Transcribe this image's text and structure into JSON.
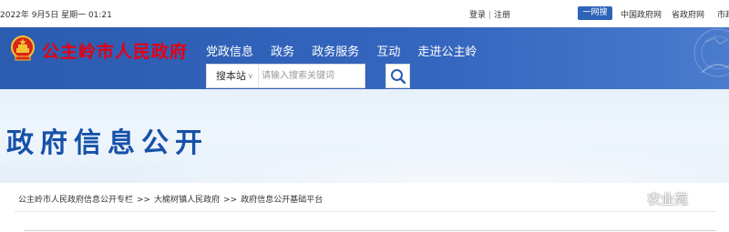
{
  "topbar": {
    "date": "2022年 9月5日 星期一 01:21",
    "login": "登录",
    "register": "注册",
    "quick_search": "一网搜",
    "links": [
      "中国政府网",
      "省政府网",
      "市政"
    ]
  },
  "header": {
    "site_name": "公主岭市人民政府",
    "nav": [
      "党政信息",
      "政务",
      "政务服务",
      "互动",
      "走进公主岭"
    ],
    "search": {
      "scope": "搜本站",
      "placeholder": "请输入搜索关键词"
    }
  },
  "banner": {
    "title": "政府信息公开"
  },
  "breadcrumb": [
    "公主岭市人民政府信息公开专栏",
    "大榆树镇人民政府",
    "政府信息公开基础平台"
  ],
  "watermark": {
    "text": "农业苑"
  },
  "colors": {
    "header_blue": "#3566bf",
    "site_name_red": "#e60012",
    "banner_title_blue": "#1651a8",
    "quick_button_blue": "#2e63b8"
  }
}
